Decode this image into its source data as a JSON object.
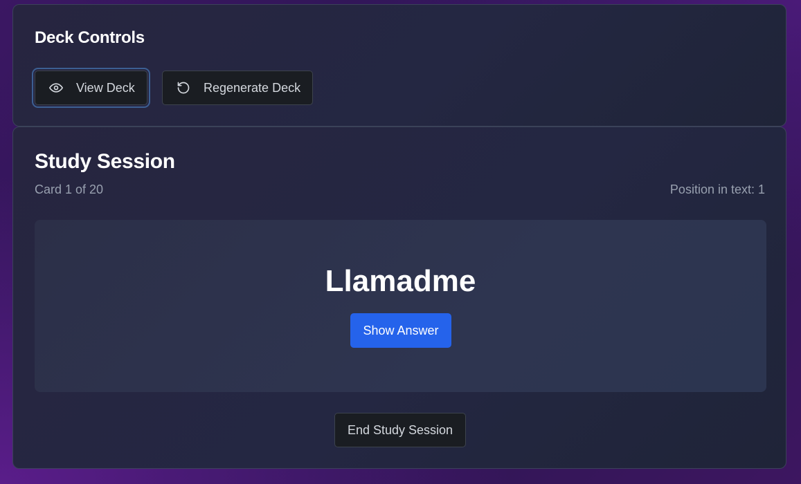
{
  "deck_controls": {
    "title": "Deck Controls",
    "view_deck": {
      "label": "View Deck",
      "icon": "eye-icon"
    },
    "regenerate_deck": {
      "label": "Regenerate Deck",
      "icon": "rotate-ccw-icon"
    }
  },
  "study_session": {
    "title": "Study Session",
    "card_counter": "Card 1 of 20",
    "position_text": "Position in text: 1",
    "card": {
      "term": "Llamadme",
      "show_answer_label": "Show Answer"
    },
    "end_session_label": "End Study Session"
  },
  "colors": {
    "accent": "#2563eb",
    "focus_ring": "#3c5f92"
  }
}
